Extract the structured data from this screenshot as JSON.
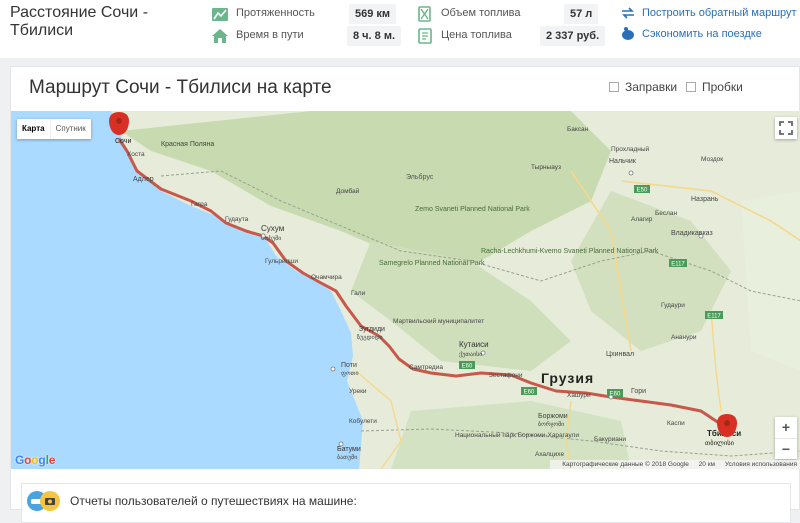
{
  "header": {
    "title_line1": "Расстояние Сочи -",
    "title_line2": "Тбилиси",
    "stats": {
      "distance_label": "Протяженность",
      "distance_value": "569 км",
      "time_label": "Время в пути",
      "time_value": "8 ч. 8 м.",
      "fuel_label": "Объем топлива",
      "fuel_value": "57 л",
      "price_label": "Цена топлива",
      "price_value": "2 337 руб."
    },
    "links": {
      "reverse_route": "Построить обратный маршрут",
      "save_trip": "Сэкономить на поездке"
    }
  },
  "map_section": {
    "heading": "Маршрут Сочи - Тбилиси на карте",
    "toggle_gas": "Заправки",
    "toggle_traffic": "Пробки",
    "map_type": {
      "map": "Карта",
      "satellite": "Спутник"
    },
    "zoom_in": "+",
    "zoom_out": "−",
    "google_logo": "Google",
    "attribution": {
      "data": "Картографические данные © 2018 Google",
      "scale": "20 км",
      "terms": "Условия использования"
    },
    "labels": {
      "sochi": "Сочи",
      "tbilisi": "Тбилиси",
      "tbilisi_geo": "თბილისი",
      "georgia": "Грузия",
      "sukhum": "Сухум",
      "sukhum_geo": "სოხუმი",
      "adler": "Адлер",
      "gagra": "Гагра",
      "hosta": "Хоста",
      "gudauta": "Гудаута",
      "ochamchira": "Очамчира",
      "gulripshi": "Гульрипши",
      "gali": "Гали",
      "zugdidi": "Зугдиди",
      "zugdidi_geo": "ზუგდიდი",
      "poti": "Поти",
      "poti_geo": "ფოთი",
      "samtredia": "Самтредиа",
      "kutaisi": "Кутаиси",
      "kutaisi_geo": "ქუთაისი",
      "zestafoni": "Зестафони",
      "khashuri": "Хашури",
      "gori": "Гори",
      "kaspi": "Каспи",
      "tskhinval": "Цхинвал",
      "borjomi": "Боржоми",
      "borjomi_geo": "ბორჯომი",
      "ureki": "Уреки",
      "kobuleti": "Кобулети",
      "batumi": "Батуми",
      "batumi_geo": "ბათუმი",
      "nalchik": "Нальчик",
      "vladikavkaz": "Владикавказ",
      "nazran": "Назрань",
      "baksan": "Баксан",
      "elbrus": "Эльбрус",
      "dombai": "Домбай",
      "krasnaya_polyana": "Красная Поляна",
      "zemo_svaneti": "Zemo Svaneti Planned National Park",
      "racha": "Racha-Lechkhumi-Kvemo Svaneti Planned National Park",
      "samegrelo": "Samegrelo Planned National Park",
      "borjomi_park": "Национальный парк Боржоми-Харагаули",
      "martvili": "Мартвильский муниципалитет",
      "bakuriani": "Бакуриани",
      "akhaltsikhe": "Ахалцихе",
      "gudauri": "Гудаури",
      "ananuri": "Ананури",
      "tyrnyauz": "Тырныауз",
      "kislovodsk_region": "Прохладный",
      "beslan": "Беслан",
      "alagir": "Алагир",
      "mozdok": "Моздок"
    },
    "road_badges": [
      "E50",
      "E117",
      "E60",
      "E60",
      "E60",
      "E117"
    ]
  },
  "reports": {
    "text": "Отчеты пользователей о путешествиях на машине:"
  },
  "colors": {
    "route": "#c9584a",
    "sea": "#aadaff",
    "land": "#e6ecd9",
    "mountains": "#c7dab0",
    "link": "#2a6fb6",
    "marker": "#d93025"
  }
}
